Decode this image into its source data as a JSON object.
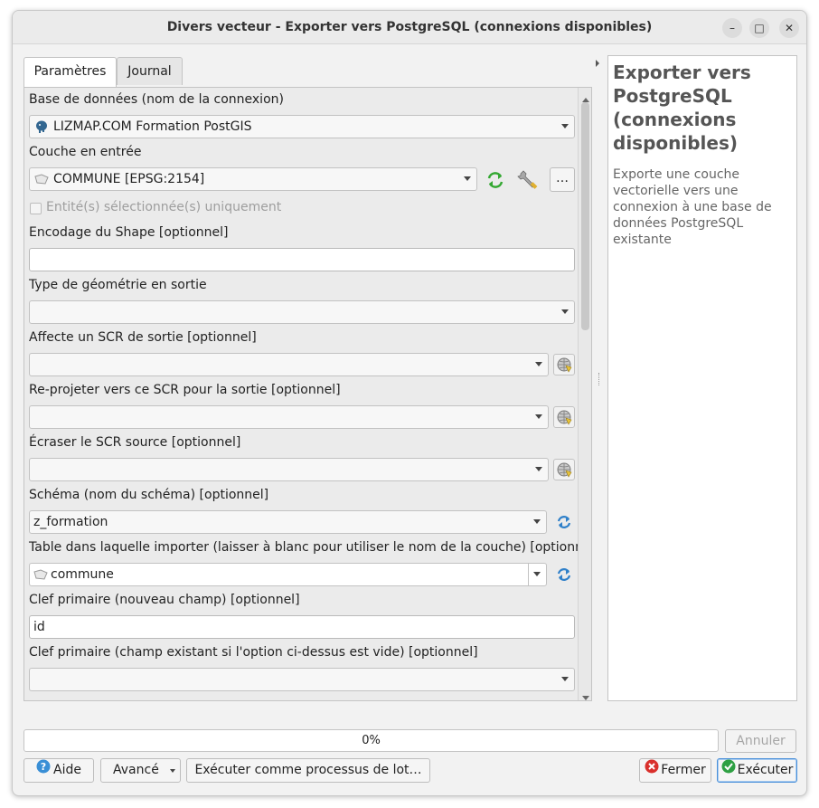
{
  "window": {
    "title": "Divers vecteur - Exporter vers PostgreSQL (connexions disponibles)",
    "controls": {
      "minimize": "–",
      "maximize": "□",
      "close": "✕"
    }
  },
  "tabs": [
    {
      "label": "Paramètres",
      "active": true
    },
    {
      "label": "Journal",
      "active": false
    }
  ],
  "params": {
    "database_label": "Base de données (nom de la connexion)",
    "database_value": "LIZMAP.COM Formation PostGIS",
    "input_layer_label": "Couche en entrée",
    "input_layer_value": "COMMUNE [EPSG:2154]",
    "ellipsis_button": "…",
    "selected_only_label": "Entité(s) sélectionnée(s) uniquement",
    "shape_encoding_label": "Encodage du Shape [optionnel]",
    "shape_encoding_value": "",
    "geometry_type_label": "Type de géométrie en sortie",
    "geometry_type_value": "",
    "assign_crs_label": "Affecte un SCR de sortie [optionnel]",
    "reproject_crs_label": "Re-projeter vers ce SCR pour la sortie [optionnel]",
    "overwrite_crs_label": "Écraser le SCR source [optionnel]",
    "schema_label": "Schéma (nom du schéma) [optionnel]",
    "schema_value": "z_formation",
    "table_label": "Table dans laquelle importer (laisser à blanc pour utiliser le nom de la couche) [optionnel]",
    "table_value": "commune",
    "pk_new_label": "Clef primaire (nouveau champ) [optionnel]",
    "pk_new_value": "id",
    "pk_existing_label": "Clef primaire (champ existant si l'option ci-dessus est vide) [optionnel]",
    "pk_existing_value": ""
  },
  "help": {
    "title": "Exporter vers PostgreSQL (connexions disponibles)",
    "description": "Exporte une couche vectorielle vers une connexion à une base de données PostgreSQL existante"
  },
  "progress": {
    "value": 0,
    "label": "0%"
  },
  "buttons": {
    "cancel": "Annuler",
    "help": "Aide",
    "advanced": "Avancé",
    "batch": "Exécuter comme processus de lot…",
    "close": "Fermer",
    "run": "Exécuter"
  },
  "colors": {
    "accent": "#3a8fd6",
    "run_border": "#4a90d9",
    "close_icon": "#d9302c",
    "run_icon": "#2ea043",
    "refresh_icon": "#2f80c9",
    "iterate_icon": "#34a832"
  }
}
